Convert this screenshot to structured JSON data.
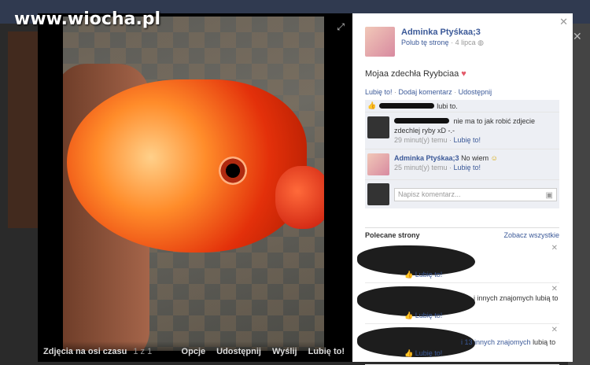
{
  "watermark": "www.wiocha.pl",
  "photo_viewer": {
    "album_title": "Zdjęcia na osi czasu",
    "counter": "1 z 1",
    "actions": [
      "Opcje",
      "Udostępnij",
      "Wyślij",
      "Lubię to!"
    ]
  },
  "post": {
    "owner": "Adminka Ptyśkaa;3",
    "like_page": "Polub tę stronę",
    "date": "4 lipca",
    "caption": "Mojaa zdechła Ryybciaa",
    "actions": [
      "Lubię to!",
      "Dodaj komentarz",
      "Udostępnij"
    ],
    "likes_text": "lubi to."
  },
  "comments": [
    {
      "author": "",
      "text": "nie ma to jak robić zdjecie zdechlej ryby xD -.-",
      "time": "29 minut(y) temu",
      "like": "Lubię to!"
    },
    {
      "author": "Adminka Ptyśkaa;3",
      "text": "No wiem",
      "time": "25 minut(y) temu",
      "like": "Lubię to!"
    }
  ],
  "comment_input": {
    "placeholder": "Napisz komentarz..."
  },
  "recommended": {
    "title": "Polecane strony",
    "see_all": "Zobacz wszystkie",
    "items": [
      {
        "text": "",
        "like": "Lubię to!"
      },
      {
        "text": "i innych znajomych lubią to",
        "like": "Lubię to!"
      },
      {
        "text": "i 13 innych znajomych",
        "text2": "lubią to",
        "like": "Lubię to!"
      }
    ]
  },
  "colors": {
    "brand": "#3b5998",
    "overlay": "#1f1f1f"
  }
}
